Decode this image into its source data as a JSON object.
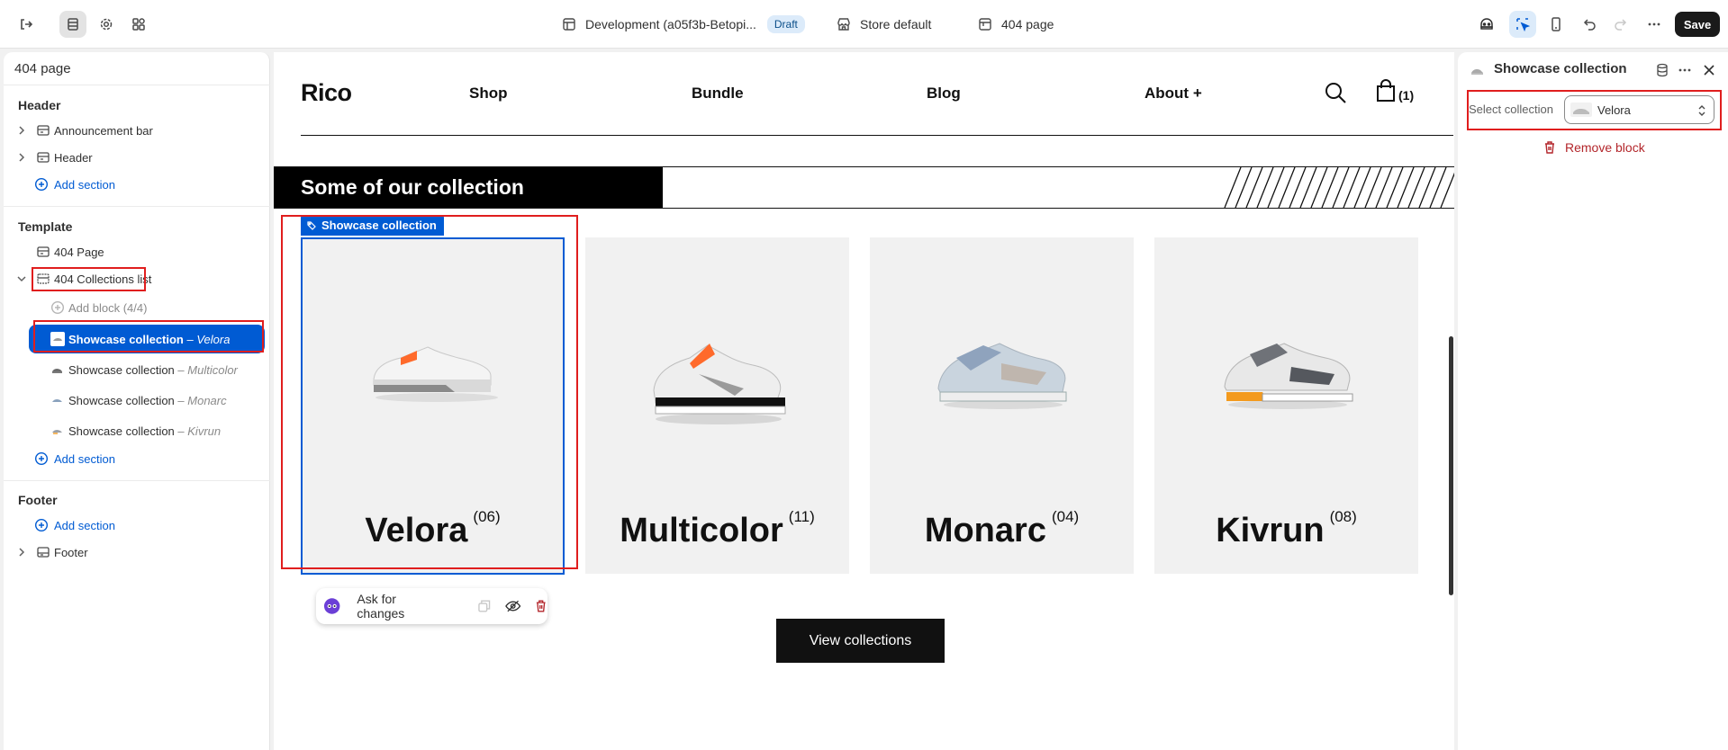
{
  "topbar": {
    "store_name": "Development (a05f3b-Betopi...",
    "status_badge": "Draft",
    "market": "Store default",
    "page": "404 page",
    "save_label": "Save"
  },
  "left_panel": {
    "title": "404 page",
    "header_group": "Header",
    "header_items": [
      "Announcement bar",
      "Header"
    ],
    "add_section": "Add section",
    "template_group": "Template",
    "template_page": "404 Page",
    "collections_list": "404 Collections list",
    "add_block": "Add block (4/4)",
    "blocks": [
      {
        "label": "Showcase collection",
        "sep": " – ",
        "value": "Velora"
      },
      {
        "label": "Showcase collection",
        "sep": " – ",
        "value": "Multicolor"
      },
      {
        "label": "Showcase collection",
        "sep": " – ",
        "value": "Monarc"
      },
      {
        "label": "Showcase collection",
        "sep": " – ",
        "value": "Kivrun"
      }
    ],
    "footer_group": "Footer",
    "footer_item": "Footer"
  },
  "preview": {
    "brand": "Rico",
    "nav": [
      "Shop",
      "Bundle",
      "Blog",
      "About +"
    ],
    "cart_count": "(1)",
    "section_title": "Some of our collection",
    "selected_tag": "Showcase collection",
    "cards": [
      {
        "name": "Velora",
        "count": "(06)"
      },
      {
        "name": "Multicolor",
        "count": "(11)"
      },
      {
        "name": "Monarc",
        "count": "(04)"
      },
      {
        "name": "Kivrun",
        "count": "(08)"
      }
    ],
    "ask_changes": "Ask for changes",
    "view_button": "View collections"
  },
  "right_panel": {
    "title": "Showcase collection",
    "select_label": "Select collection",
    "select_value": "Velora",
    "remove_label": "Remove block"
  },
  "colors": {
    "accent_blue": "#005bd3",
    "highlight_red": "#e01e1e",
    "danger": "#b3262b"
  }
}
